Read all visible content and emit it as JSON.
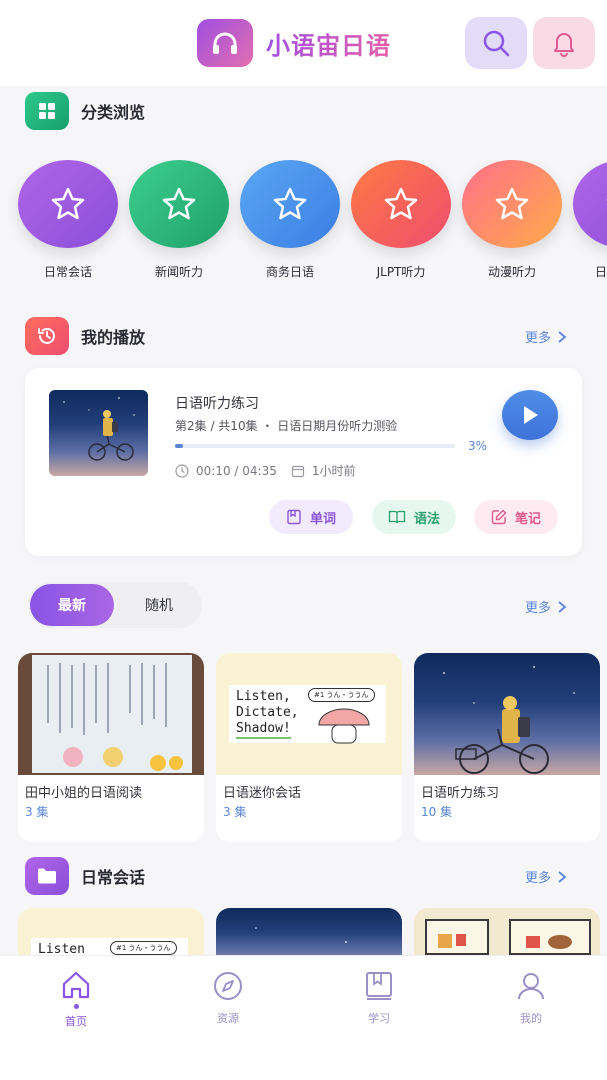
{
  "header": {
    "app_title": "小语宙日语",
    "logo_icon": "headphones-icon",
    "search_icon": "search-icon",
    "bell_icon": "bell-icon"
  },
  "categories_section": {
    "title": "分类浏览",
    "icon": "grid-icon"
  },
  "categories": [
    {
      "label": "日常会话",
      "color_from": "#b065e8",
      "color_to": "#8a4fd9"
    },
    {
      "label": "新闻听力",
      "color_from": "#3ecf8f",
      "color_to": "#1ea06a"
    },
    {
      "label": "商务日语",
      "color_from": "#5aa7f5",
      "color_to": "#3b7ee3"
    },
    {
      "label": "JLPT听力",
      "color_from": "#ff7a45",
      "color_to": "#ee4d6e"
    },
    {
      "label": "动漫听力",
      "color_from": "#ff6f8a",
      "color_to": "#ffab4a"
    },
    {
      "label": "日",
      "color_from": "#b065e8",
      "color_to": "#8a4fd9"
    }
  ],
  "playing_section": {
    "title": "我的播放",
    "more": "更多",
    "icon": "history-icon"
  },
  "now_playing": {
    "title": "日语听力练习",
    "subtitle": "第2集 / 共10集 ・ 日语日期月份听力测验",
    "progress_fraction": 0.03,
    "progress_text": "3%",
    "time": "00:10 / 04:35",
    "updated": "1小时前",
    "chips": {
      "vocab": "单词",
      "grammar": "语法",
      "notes": "笔记"
    }
  },
  "toggle": {
    "active": "最新",
    "inactive": "随机",
    "more": "更多"
  },
  "latest_cards": [
    {
      "title": "田中小姐的日语阅读",
      "count": "3 集"
    },
    {
      "title": "日语迷你会话",
      "count": "3 集"
    },
    {
      "title": "日语听力练习",
      "count": "10 集"
    }
  ],
  "daily_section": {
    "title": "日常会话",
    "more": "更多",
    "icon": "folder-icon"
  },
  "thumb_text": {
    "listen_line1": "Listen,",
    "listen_line2": "Dictate,",
    "listen_line3": "Shadow!",
    "bubble": "#1 うん・ううん",
    "listen_short": "Listen"
  },
  "nav": [
    {
      "label": "首页",
      "icon": "home-icon",
      "active": true
    },
    {
      "label": "资源",
      "icon": "compass-icon",
      "active": false
    },
    {
      "label": "学习",
      "icon": "book-icon",
      "active": false
    },
    {
      "label": "我的",
      "icon": "user-icon",
      "active": false
    }
  ],
  "colors": {
    "accent": "#8a54e6",
    "link": "#5a86d8",
    "active_nav": "#8a54e6",
    "inactive_nav": "#9b8fc7"
  }
}
